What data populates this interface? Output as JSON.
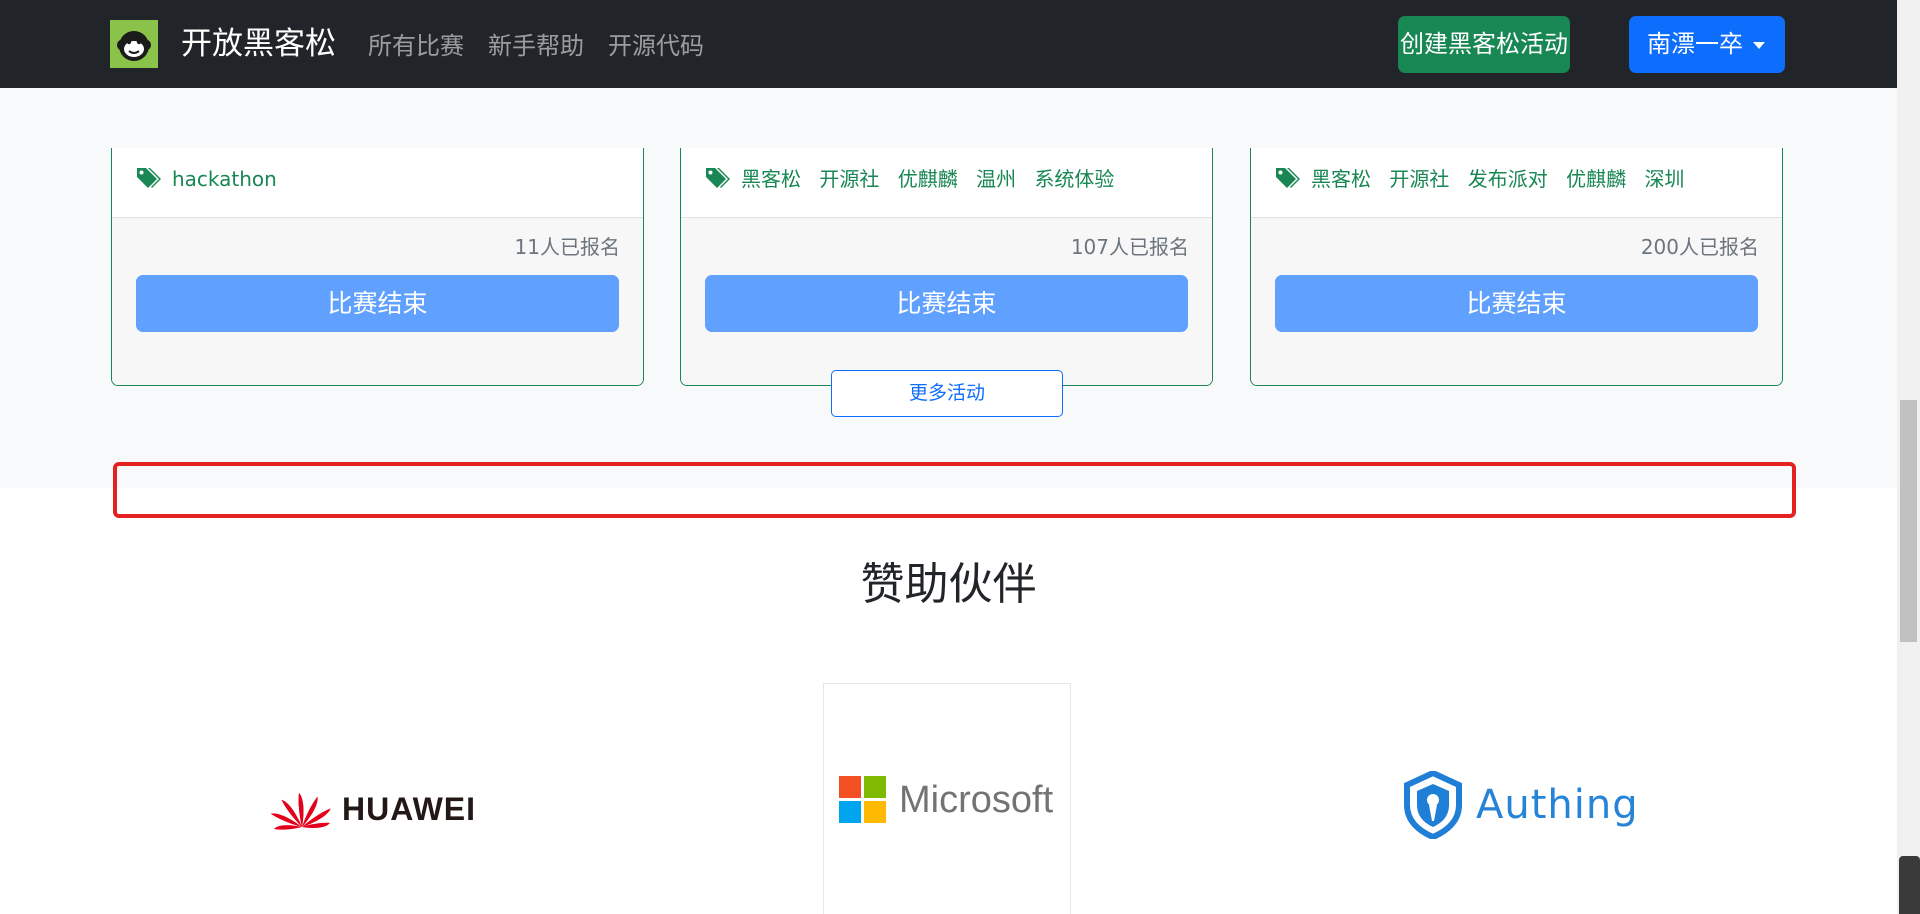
{
  "navbar": {
    "brand": "开放黑客松",
    "links": [
      "所有比赛",
      "新手帮助",
      "开源代码"
    ],
    "create_button": "创建黑客松活动",
    "user_button": "南漂一卒"
  },
  "cards": [
    {
      "tags": [
        "hackathon"
      ],
      "signup": "11人已报名",
      "button": "比赛结束"
    },
    {
      "tags": [
        "黑客松",
        "开源社",
        "优麒麟",
        "温州",
        "系统体验"
      ],
      "signup": "107人已报名",
      "button": "比赛结束"
    },
    {
      "tags": [
        "黑客松",
        "开源社",
        "发布派对",
        "优麒麟",
        "深圳"
      ],
      "signup": "200人已报名",
      "button": "比赛结束"
    }
  ],
  "more_button": "更多活动",
  "sponsors": {
    "title": "赞助伙伴",
    "huawei": "HUAWEI",
    "microsoft": "Microsoft",
    "authing": "Authing"
  },
  "colors": {
    "navbar": "#212529",
    "success": "#198754",
    "primary": "#0d6efd",
    "ended_button": "#60a0fe",
    "highlight": "#e52222"
  }
}
